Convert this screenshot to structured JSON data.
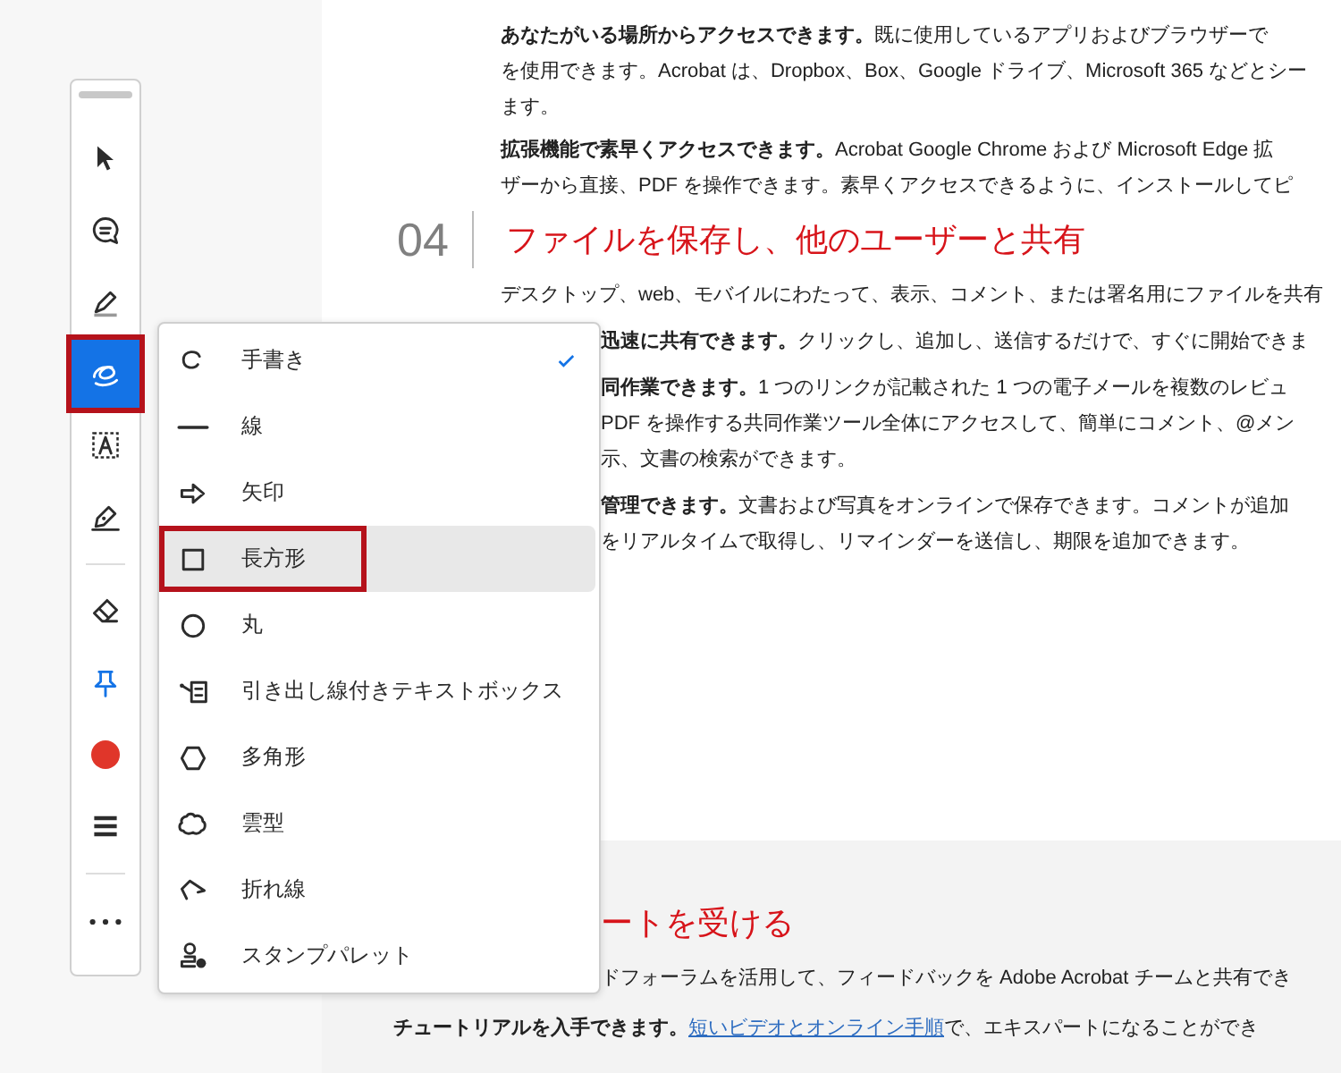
{
  "toolbar": {
    "tools": [
      {
        "kind": "select",
        "selected": false,
        "highlighted": false
      },
      {
        "kind": "comment",
        "selected": false,
        "highlighted": false
      },
      {
        "kind": "highlight",
        "selected": false,
        "highlighted": false
      },
      {
        "kind": "draw",
        "selected": true,
        "highlighted": true
      },
      {
        "kind": "textbox",
        "selected": false,
        "highlighted": false
      },
      {
        "kind": "sign",
        "selected": false,
        "highlighted": false
      },
      {
        "kind": "divider"
      },
      {
        "kind": "eraser",
        "selected": false,
        "highlighted": false
      },
      {
        "kind": "pin",
        "selected": false,
        "highlighted": false
      },
      {
        "kind": "color",
        "selected": false,
        "highlighted": false,
        "color": "#e0362a"
      },
      {
        "kind": "stroke",
        "selected": false,
        "highlighted": false
      },
      {
        "kind": "divider"
      },
      {
        "kind": "more",
        "selected": false,
        "highlighted": false
      }
    ]
  },
  "menu": {
    "items": [
      {
        "kind": "freehand",
        "label": "手書き",
        "checked": true,
        "selected": false,
        "highlighted": false
      },
      {
        "kind": "line",
        "label": "線",
        "checked": false,
        "selected": false,
        "highlighted": false
      },
      {
        "kind": "arrow",
        "label": "矢印",
        "checked": false,
        "selected": false,
        "highlighted": false
      },
      {
        "kind": "rectangle",
        "label": "長方形",
        "checked": false,
        "selected": true,
        "highlighted": true
      },
      {
        "kind": "circle",
        "label": "丸",
        "checked": false,
        "selected": false,
        "highlighted": false
      },
      {
        "kind": "callout",
        "label": "引き出し線付きテキストボックス",
        "checked": false,
        "selected": false,
        "highlighted": false
      },
      {
        "kind": "polygon",
        "label": "多角形",
        "checked": false,
        "selected": false,
        "highlighted": false
      },
      {
        "kind": "cloud",
        "label": "雲型",
        "checked": false,
        "selected": false,
        "highlighted": false
      },
      {
        "kind": "polyline",
        "label": "折れ線",
        "checked": false,
        "selected": false,
        "highlighted": false
      },
      {
        "kind": "stamp",
        "label": "スタンプパレット",
        "checked": false,
        "selected": false,
        "highlighted": false
      }
    ]
  },
  "document": {
    "blocks": [
      {
        "kind": "paragraph",
        "covered": false,
        "lines": [
          "**あなたがいる場所からアクセスできます。**既に使用しているアプリおよびブラウザーで",
          "を使用できます。Acrobat は、Dropbox、Box、Google ドライブ、Microsoft 365 などとシー",
          "ます。"
        ]
      },
      {
        "kind": "paragraph",
        "covered": false,
        "lines": [
          "**拡張機能で素早くアクセスできます。**Acrobat Google Chrome および Microsoft Edge 拡",
          "ザーから直接、PDF を操作できます。素早くアクセスできるように、インストールしてピ"
        ]
      },
      {
        "kind": "heading",
        "number": "04",
        "title": "ファイルを保存し、他のユーザーと共有"
      },
      {
        "kind": "paragraph",
        "covered": false,
        "lines": [
          "デスクトップ、web、モバイルにわたって、表示、コメント、または署名用にファイルを共有"
        ]
      },
      {
        "kind": "paragraph",
        "covered": true,
        "lines": [
          "**迅速に共有できます。**クリックし、追加し、送信するだけで、すぐに開始できま"
        ]
      },
      {
        "kind": "paragraph",
        "covered": true,
        "lines": [
          "**同作業できます。**1 つのリンクが記載された 1 つの電子メールを複数のレビュ",
          "PDF を操作する共同作業ツール全体にアクセスして、簡単にコメント、@メン",
          "示、文書の検索ができます。"
        ]
      },
      {
        "kind": "paragraph",
        "covered": true,
        "lines": [
          "**管理できます。**文書および写真をオンラインで保存できます。コメントが追加",
          "をリアルタイムで取得し、リマインダーを送信し、期限を追加できます。"
        ]
      }
    ]
  },
  "lower_section": {
    "title": "ートを受ける",
    "paragraphs": [
      {
        "covered": true,
        "segments": [
          {
            "kind": "text",
            "text": "ドフォーラムを活用して、フィードバックを Adobe Acrobat チームと共有でき"
          }
        ]
      },
      {
        "covered": false,
        "segments": [
          {
            "kind": "text",
            "text": "**チュートリアルを入手できます。**"
          },
          {
            "kind": "link",
            "text": "短いビデオとオンライン手順"
          },
          {
            "kind": "text",
            "text": "で、エキスパートになることができ"
          }
        ]
      }
    ]
  }
}
